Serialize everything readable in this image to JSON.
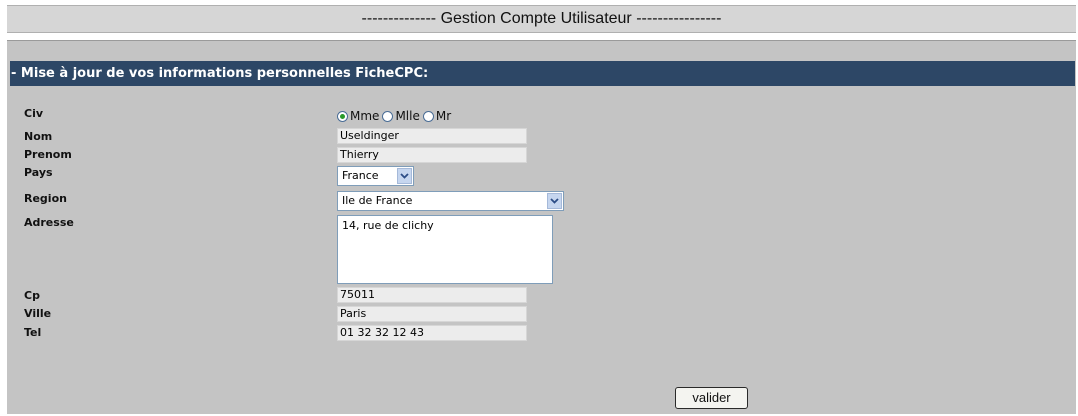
{
  "page": {
    "title": "-------------- Gestion Compte Utilisateur ----------------"
  },
  "section": {
    "header": "- Mise à jour de vos informations personnelles FicheCPC:"
  },
  "form": {
    "civ": {
      "label": "Civ",
      "options": [
        "Mme",
        "Mlle",
        "Mr"
      ],
      "selected": "Mme"
    },
    "nom": {
      "label": "Nom",
      "value": "Useldinger"
    },
    "prenom": {
      "label": "Prenom",
      "value": "Thierry"
    },
    "pays": {
      "label": "Pays",
      "value": "France"
    },
    "region": {
      "label": "Region",
      "value": "Ile de France"
    },
    "adresse": {
      "label": "Adresse",
      "value": "14, rue de clichy"
    },
    "cp": {
      "label": "Cp",
      "value": "75011"
    },
    "ville": {
      "label": "Ville",
      "value": "Paris"
    },
    "tel": {
      "label": "Tel",
      "value": "01 32 32 12 43"
    },
    "submit_label": "valider"
  },
  "colors": {
    "header_bg": "#2d4766",
    "panel_bg": "#c4c4c4",
    "radio_checked": "#2a9a2a"
  },
  "icons": {
    "dropdown": "chevron-down-icon"
  }
}
